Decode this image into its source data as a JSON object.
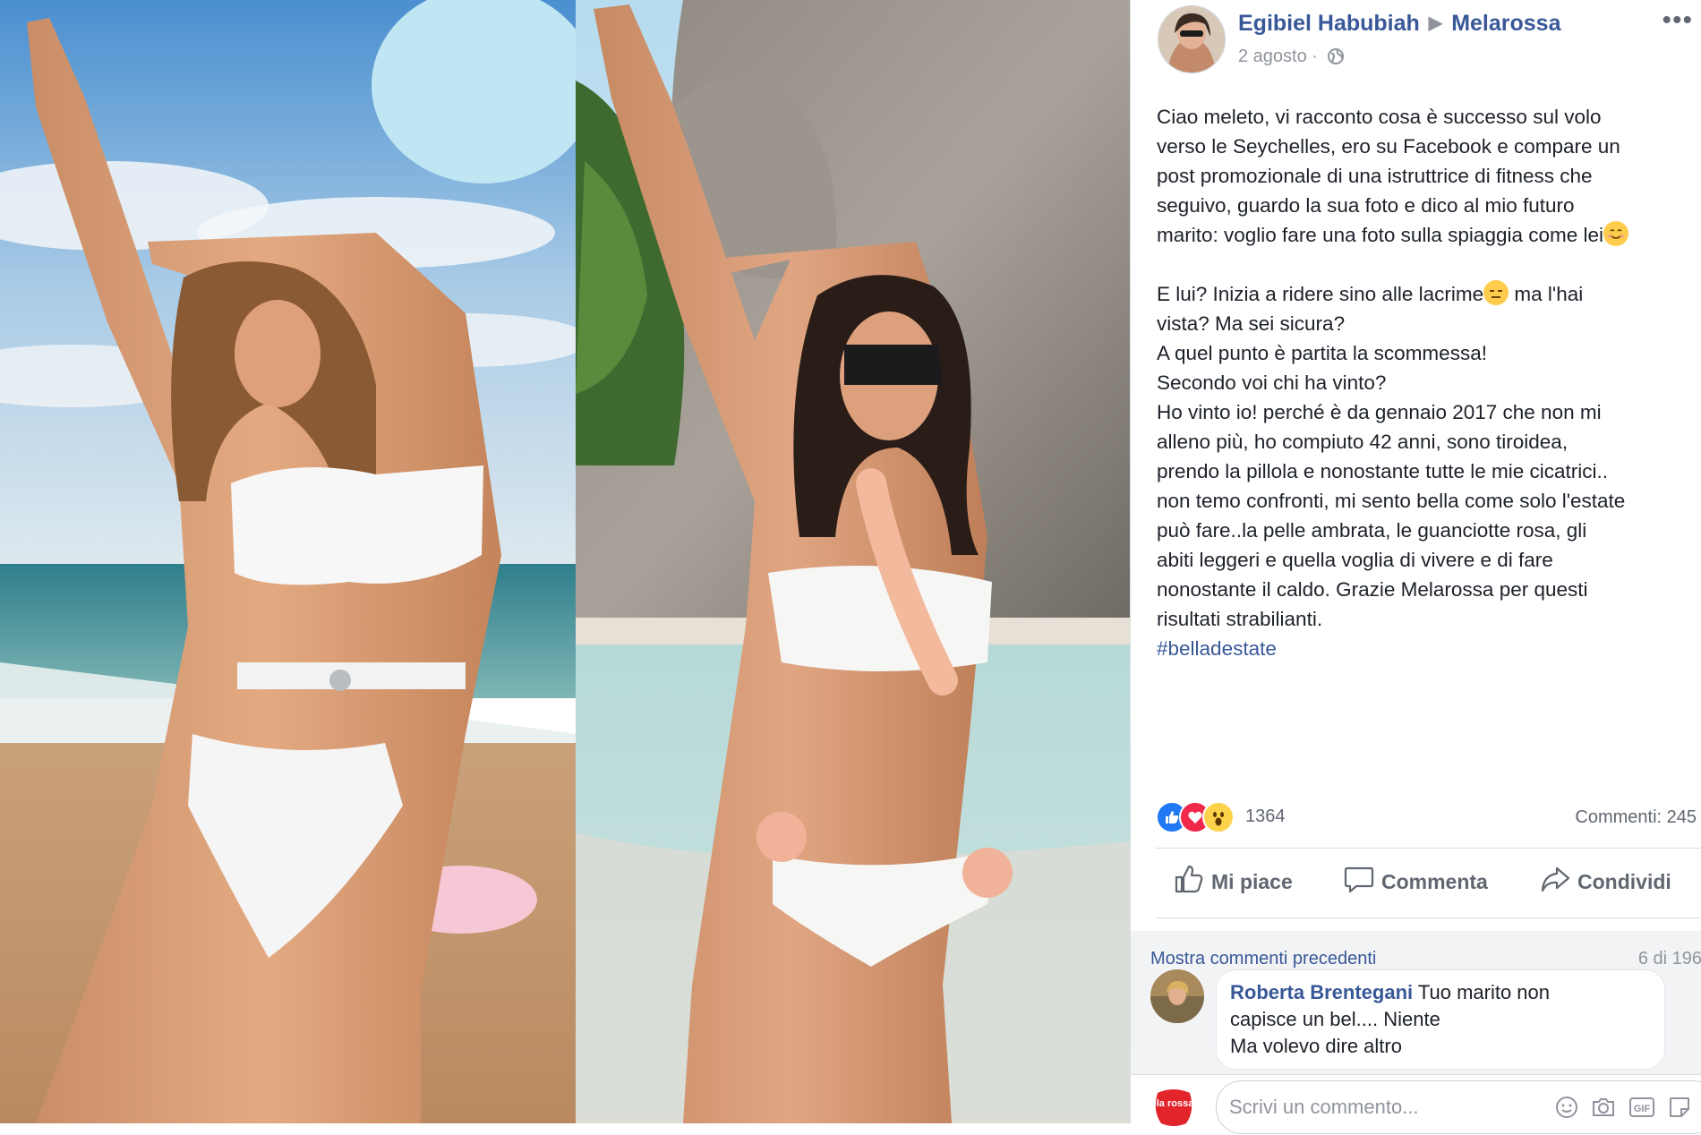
{
  "post": {
    "author": "Egibiel Habubiah",
    "page": "Melarossa",
    "date": "2 agosto",
    "separator": "·",
    "more": "•••",
    "lines": [
      "Ciao meleto, vi racconto cosa è successo sul volo",
      "verso le Seychelles, ero su Facebook e compare un",
      "post promozionale di una istruttrice di fitness che",
      "seguivo, guardo la sua foto e dico al mio futuro",
      "marito: voglio fare una foto sulla spiaggia come lei",
      "E lui? Inizia a ridere sino alle lacrime",
      " ma l'hai",
      "vista? Ma sei sicura?",
      "A quel punto è partita la scommessa!",
      "Secondo voi chi ha vinto?",
      "Ho vinto io! perché è da gennaio 2017 che non mi",
      "alleno più, ho compiuto 42 anni, sono tiroidea,",
      "prendo la pillola e nonostante tutte le mie cicatrici..",
      "non temo confronti, mi sento bella come solo l'estate",
      "può fare..la pelle ambrata, le guanciotte rosa, gli",
      "abiti leggeri e quella voglia di vivere e di fare",
      "nonostante il caldo. Grazie Melarossa per questi",
      "risultati strabilianti."
    ],
    "hashtag": "#belladestate"
  },
  "stats": {
    "reactions_count": "1364",
    "comments_count": "Commenti: 245"
  },
  "actions": {
    "like": "Mi piace",
    "comment": "Commenta",
    "share": "Condividi"
  },
  "comments": {
    "show_previous": "Mostra commenti precedenti",
    "count": "6 di 196",
    "items": [
      {
        "author": "Roberta Brentegani",
        "text_line1": " Tuo marito non",
        "text_line2": "capisce un bel.... Niente",
        "text_line3": "Ma volevo dire altro"
      }
    ],
    "write_placeholder": "Scrivi un commento...",
    "brand_logo_text": "mela rossa .it",
    "gif_label": "GIF"
  },
  "colors": {
    "link": "#385898",
    "secondary": "#90949c",
    "like_blue": "#2078f4",
    "love_red": "#f0284a"
  }
}
